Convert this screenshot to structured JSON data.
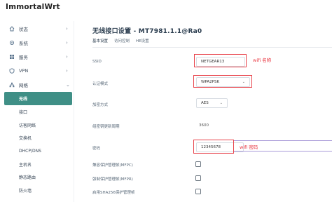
{
  "brand": "ImmortalWrt",
  "sidebar": {
    "items": [
      {
        "label": "状态",
        "icon": "dashboard-icon"
      },
      {
        "label": "系统",
        "icon": "gear-icon"
      },
      {
        "label": "服务",
        "icon": "services-icon"
      },
      {
        "label": "VPN",
        "icon": "vpn-icon"
      },
      {
        "label": "网络",
        "icon": "network-icon"
      }
    ],
    "network_sub": [
      "无线",
      "接口",
      "访客网络",
      "交换机",
      "DHCP/DNS",
      "主机名",
      "静态路由",
      "防火墙"
    ]
  },
  "main": {
    "title": "无线接口设置 - MT7981.1.1@Ra0",
    "tabs": [
      "基本设置",
      "访问控制",
      "HE设置"
    ],
    "rows": {
      "ssid_label": "SSID",
      "ssid_value": "NETGEAR13",
      "auth_label": "认证模式",
      "auth_value": "WPA2PSK",
      "enc_label": "加密方式",
      "enc_value": "AES",
      "rekey_label": "组密钥更新周期",
      "rekey_value": "3600",
      "pwd_label": "密码",
      "pwd_value": "12345678",
      "mfpc_label": "兼容保护管理帧(MFPC)",
      "mfpr_label": "强制保护管理帧(MFPR)",
      "sha256_label": "启用SHA256保护管理帧"
    },
    "annotations": {
      "wifi_name": "wifi 名称",
      "wifi_pwd": "wifi 密码"
    }
  }
}
